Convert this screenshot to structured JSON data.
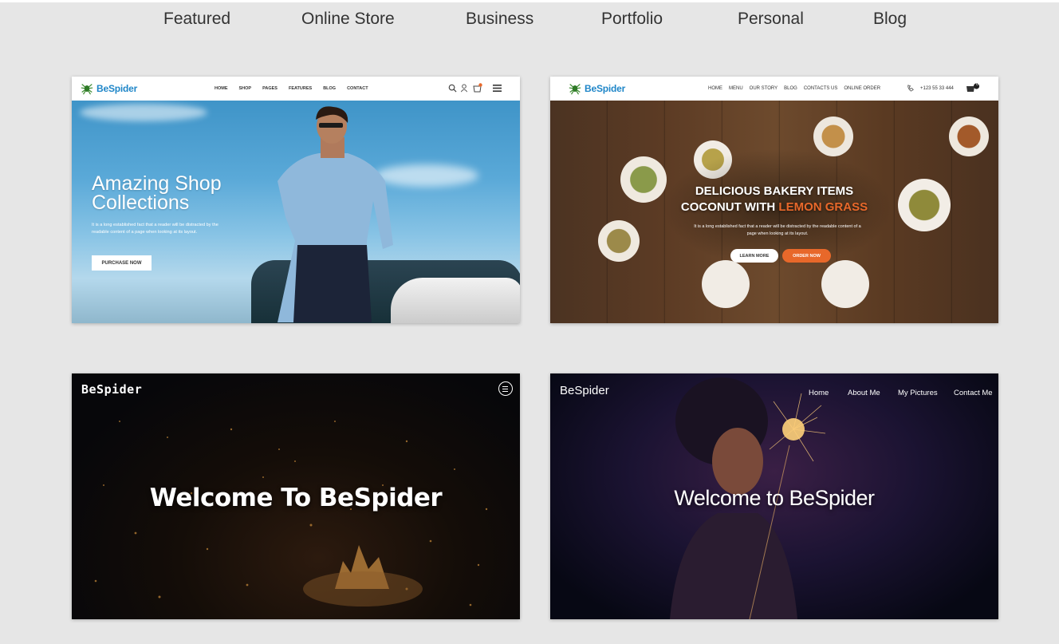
{
  "filter_tabs": [
    "Featured",
    "Online Store",
    "Business",
    "Portfolio",
    "Personal",
    "Blog"
  ],
  "colors": {
    "page_bg": "#e6e6e6",
    "logo_blue": "#1f86c8",
    "accent_orange": "#e8682a"
  },
  "card_shop": {
    "logo": "BeSpider",
    "menu": [
      "HOME",
      "SHOP",
      "PAGES",
      "FEATURES",
      "BLOG",
      "CONTACT"
    ],
    "icons": [
      "search-icon",
      "user-icon",
      "cart-icon",
      "hamburger-icon"
    ],
    "title_line1": "Amazing Shop",
    "title_line2": "Collections",
    "text": "It is a long established fact that a reader will be distracted by the readable content of a page when looking at its layout.",
    "button": "PURCHASE NOW"
  },
  "card_restaurant": {
    "logo": "BeSpider",
    "menu": [
      "HOME",
      "MENU",
      "OUR STORY",
      "BLOG",
      "CONTACTS US",
      "ONLINE ORDER"
    ],
    "phone": "+123 55 33 444",
    "cart_count": "0",
    "title_line1": "DELICIOUS BAKERY ITEMS",
    "title_line2": "COCONUT WITH",
    "title_highlight": "LEMON GRASS",
    "text": "It is a long established fact that a reader will be distracted by the readable content of a page when looking at its layout.",
    "button_primary": "LEARN MORE",
    "button_secondary": "ORDER NOW"
  },
  "card_city": {
    "logo": "BeSpider",
    "title": "Welcome To BeSpider"
  },
  "card_personal": {
    "logo": "BeSpider",
    "nav": [
      "Home",
      "About Me",
      "My Pictures",
      "Contact Me"
    ],
    "title": "Welcome to BeSpider"
  }
}
